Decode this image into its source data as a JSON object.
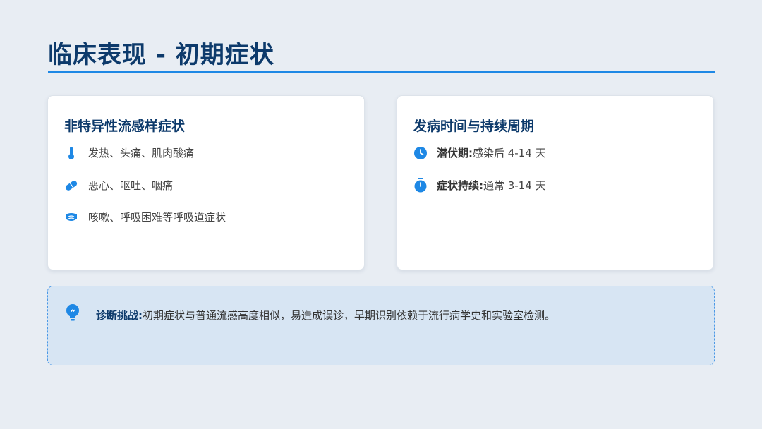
{
  "page": {
    "title": "临床表现 - 初期症状"
  },
  "symptoms_card": {
    "title": "非特异性流感样症状",
    "items": [
      {
        "icon": "thermometer-icon",
        "text": "发热、头痛、肌肉酸痛"
      },
      {
        "icon": "pill-icon",
        "text": "恶心、呕吐、咽痛"
      },
      {
        "icon": "mask-icon",
        "text": "咳嗽、呼吸困难等呼吸道症状"
      }
    ]
  },
  "timing_card": {
    "title": "发病时间与持续周期",
    "items": [
      {
        "icon": "clock-icon",
        "label": "潜伏期:",
        "text": "感染后 4-14 天"
      },
      {
        "icon": "stopwatch-icon",
        "label": "症状持续:",
        "text": "通常 3-14 天"
      }
    ]
  },
  "callout": {
    "icon": "lightbulb-icon",
    "label": "诊断挑战:",
    "text": "初期症状与普通流感高度相似，易造成误诊，早期识别依赖于流行病学史和实验室检测。"
  },
  "colors": {
    "title": "#0d3a6b",
    "accent": "#1e88e5",
    "background": "#e8edf3",
    "callout_bg": "#d7e5f3"
  }
}
